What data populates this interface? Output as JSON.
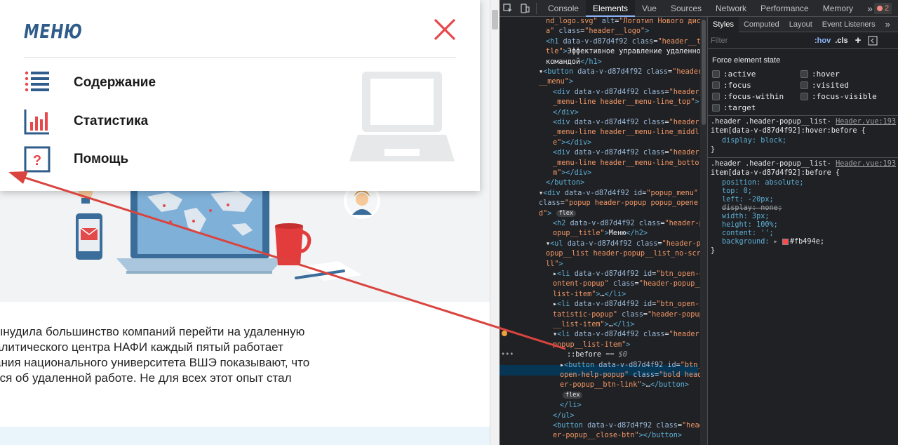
{
  "popup": {
    "title": "МЕНЮ",
    "items": [
      {
        "label": "Содержание",
        "icon": "list-icon"
      },
      {
        "label": "Статистика",
        "icon": "bar-chart-icon"
      },
      {
        "label": "Помощь",
        "icon": "help-icon"
      }
    ],
    "help_glyph": "?",
    "close_icon": "close-icon",
    "accent_color": "#e8474b",
    "brand_color": "#2f5c8a"
  },
  "article": {
    "lines": [
      "ынудила большинство компаний перейти на удаленную",
      "алитического центра НАФИ каждый пятый работает",
      "ания национального университета ВШЭ показывают, что",
      "тся об удаленной работе. Не для всех этот опыт стал"
    ]
  },
  "devtools": {
    "tabs": [
      "Console",
      "Elements",
      "Vue",
      "Sources",
      "Network",
      "Performance",
      "Memory"
    ],
    "active_tab": "Elements",
    "more": "»",
    "error_count": "2",
    "flex_badge": "flex",
    "dots": "•••",
    "styles_tabs": [
      "Styles",
      "Computed",
      "Layout",
      "Event Listeners"
    ],
    "styles_more": "»",
    "filter_placeholder": "Filter",
    "hov": ":hov",
    "cls": ".cls",
    "plus": "+",
    "force_state_title": "Force element state",
    "states_left": [
      ":active",
      ":focus",
      ":focus-within",
      ":target"
    ],
    "states_right": [
      ":hover",
      ":visited",
      ":focus-visible"
    ],
    "rule1": {
      "selector_1": ".header .header-popup__list-",
      "selector_2": "item[data-v-d87d4f92]:hover:before {",
      "source": "Header.vue:193",
      "decl": "display: block;",
      "close": "}"
    },
    "rule2": {
      "selector_1": ".header .header-popup__list-",
      "selector_2": "item[data-v-d87d4f92]:before {",
      "source": "Header.vue:193",
      "decls": [
        "position: absolute;",
        "top: 0;",
        "left: -20px;",
        "display: none;",
        "width: 3px;",
        "height: 100%;",
        "content: '';",
        "background:"
      ],
      "bg_value": "#fb494e;",
      "close": "}"
    }
  }
}
